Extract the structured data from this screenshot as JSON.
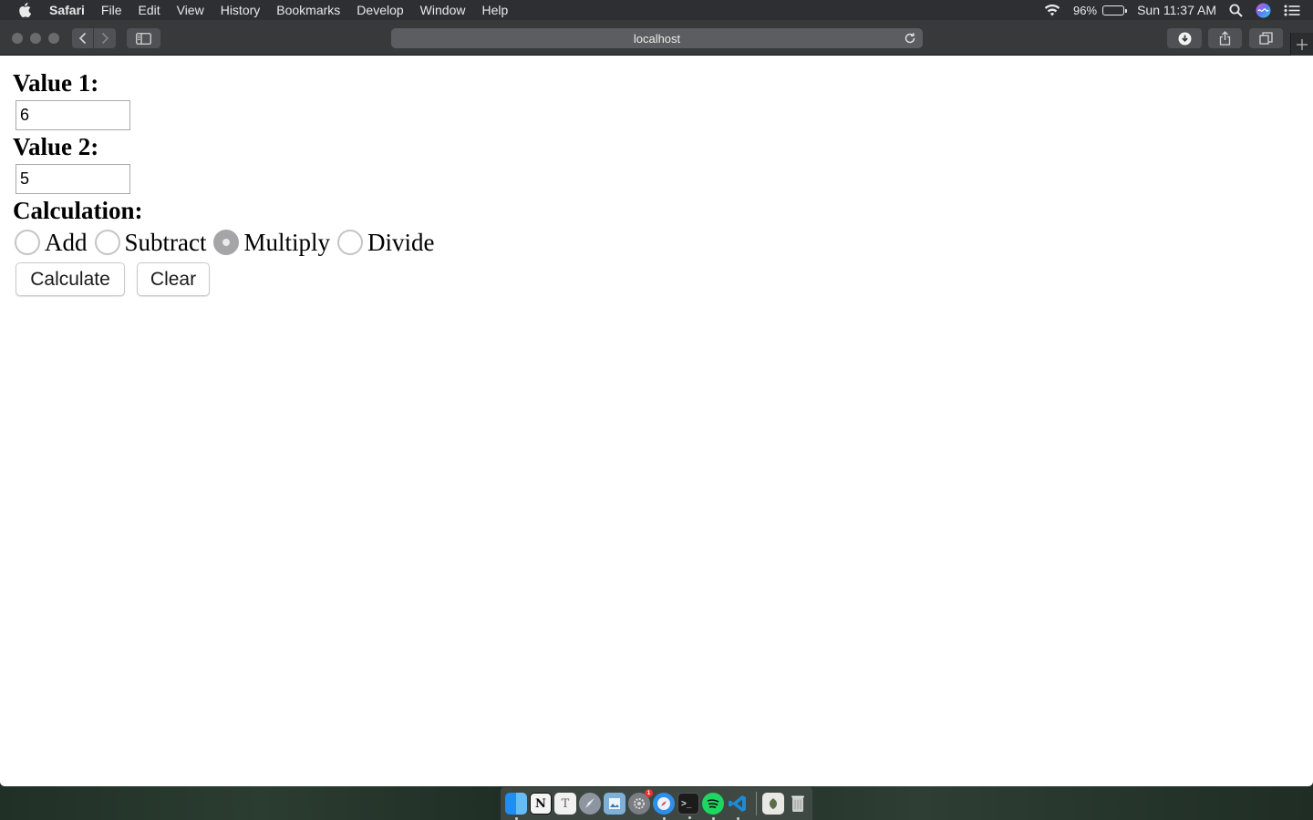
{
  "menubar": {
    "app_name": "Safari",
    "menus": [
      "File",
      "Edit",
      "View",
      "History",
      "Bookmarks",
      "Develop",
      "Window",
      "Help"
    ],
    "battery_percent": "96%",
    "clock": "Sun 11:37 AM"
  },
  "browser": {
    "address": "localhost"
  },
  "form": {
    "value1_label": "Value 1:",
    "value1": "6",
    "value2_label": "Value 2:",
    "value2": "5",
    "calc_label": "Calculation:",
    "options": [
      {
        "label": "Add",
        "checked": false
      },
      {
        "label": "Subtract",
        "checked": false
      },
      {
        "label": "Multiply",
        "checked": true
      },
      {
        "label": "Divide",
        "checked": false
      }
    ],
    "calculate_button": "Calculate",
    "clear_button": "Clear"
  },
  "dock": {
    "apps": [
      "finder-icon",
      "notion-icon",
      "typora-icon",
      "launchpad-icon",
      "preview-icon",
      "system-preferences-icon",
      "safari-icon",
      "terminal-icon",
      "spotify-icon",
      "vscode-icon",
      "downloads-stack-icon",
      "trash-icon"
    ],
    "notification_badge": "1"
  }
}
